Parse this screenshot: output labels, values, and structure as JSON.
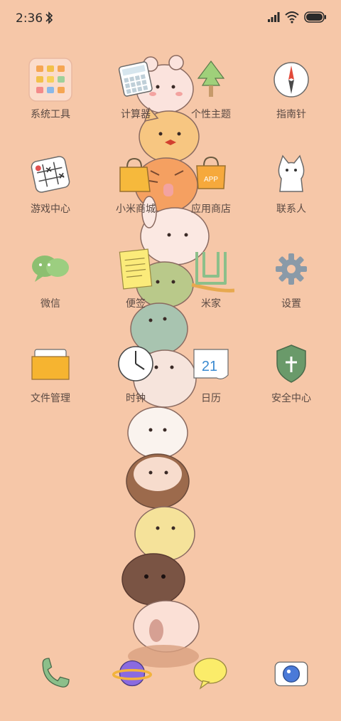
{
  "status": {
    "time": "2:36",
    "icons": [
      "bluetooth-icon",
      "signal-icon",
      "wifi-icon",
      "battery-icon"
    ]
  },
  "apps": [
    {
      "label": "系统工具",
      "icon": "folder-icon"
    },
    {
      "label": "计算器",
      "icon": "calculator-icon"
    },
    {
      "label": "个性主题",
      "icon": "theme-icon"
    },
    {
      "label": "指南针",
      "icon": "compass-icon"
    },
    {
      "label": "游戏中心",
      "icon": "game-icon"
    },
    {
      "label": "小米商城",
      "icon": "shop-bag-icon"
    },
    {
      "label": "应用商店",
      "icon": "app-store-icon"
    },
    {
      "label": "联系人",
      "icon": "contacts-cat-icon"
    },
    {
      "label": "微信",
      "icon": "wechat-icon"
    },
    {
      "label": "便签",
      "icon": "notes-icon"
    },
    {
      "label": "米家",
      "icon": "mijia-icon"
    },
    {
      "label": "设置",
      "icon": "settings-gear-icon"
    },
    {
      "label": "文件管理",
      "icon": "file-folder-icon"
    },
    {
      "label": "时钟",
      "icon": "clock-icon"
    },
    {
      "label": "日历",
      "icon": "calendar-icon"
    },
    {
      "label": "安全中心",
      "icon": "security-shield-icon"
    }
  ],
  "calendar_day": "21",
  "app_store_badge": "APP",
  "dock": [
    "phone-icon",
    "browser-planet-icon",
    "messages-bubble-icon",
    "camera-icon"
  ],
  "colors": {
    "background": "#f6c7a8",
    "label": "#5b4a43"
  }
}
